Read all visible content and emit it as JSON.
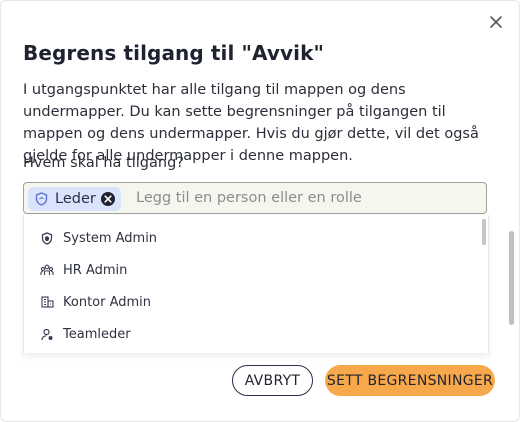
{
  "dialog": {
    "title": "Begrens tilgang til \"Avvik\"",
    "description": "I utgangspunktet har alle tilgang til mappen og dens undermapper. Du kan sette begrensninger på tilgangen til mappen og dens undermapper. Hvis du gjør dette, vil det også gjelde for alle undermapper i denne mappen.",
    "question": "Hvem skal ha tilgang?",
    "close_icon": "close-icon"
  },
  "tag_input": {
    "selected": [
      {
        "label": "Leder",
        "icon": "shield-icon"
      }
    ],
    "placeholder": "Legg til en person eller en rolle",
    "value": ""
  },
  "dropdown": {
    "options": [
      {
        "label": "System Admin",
        "icon": "shield-icon"
      },
      {
        "label": "HR Admin",
        "icon": "people-icon"
      },
      {
        "label": "Kontor Admin",
        "icon": "building-icon"
      },
      {
        "label": "Teamleder",
        "icon": "user-badge-icon"
      }
    ]
  },
  "buttons": {
    "cancel": "AVBRYT",
    "apply": "SETT BEGRENSNINGER"
  },
  "colors": {
    "chip_bg": "#d9e3fb",
    "input_bg": "#f5f7ee",
    "primary_button": "#f7a84a",
    "text": "#2c2f3a"
  }
}
